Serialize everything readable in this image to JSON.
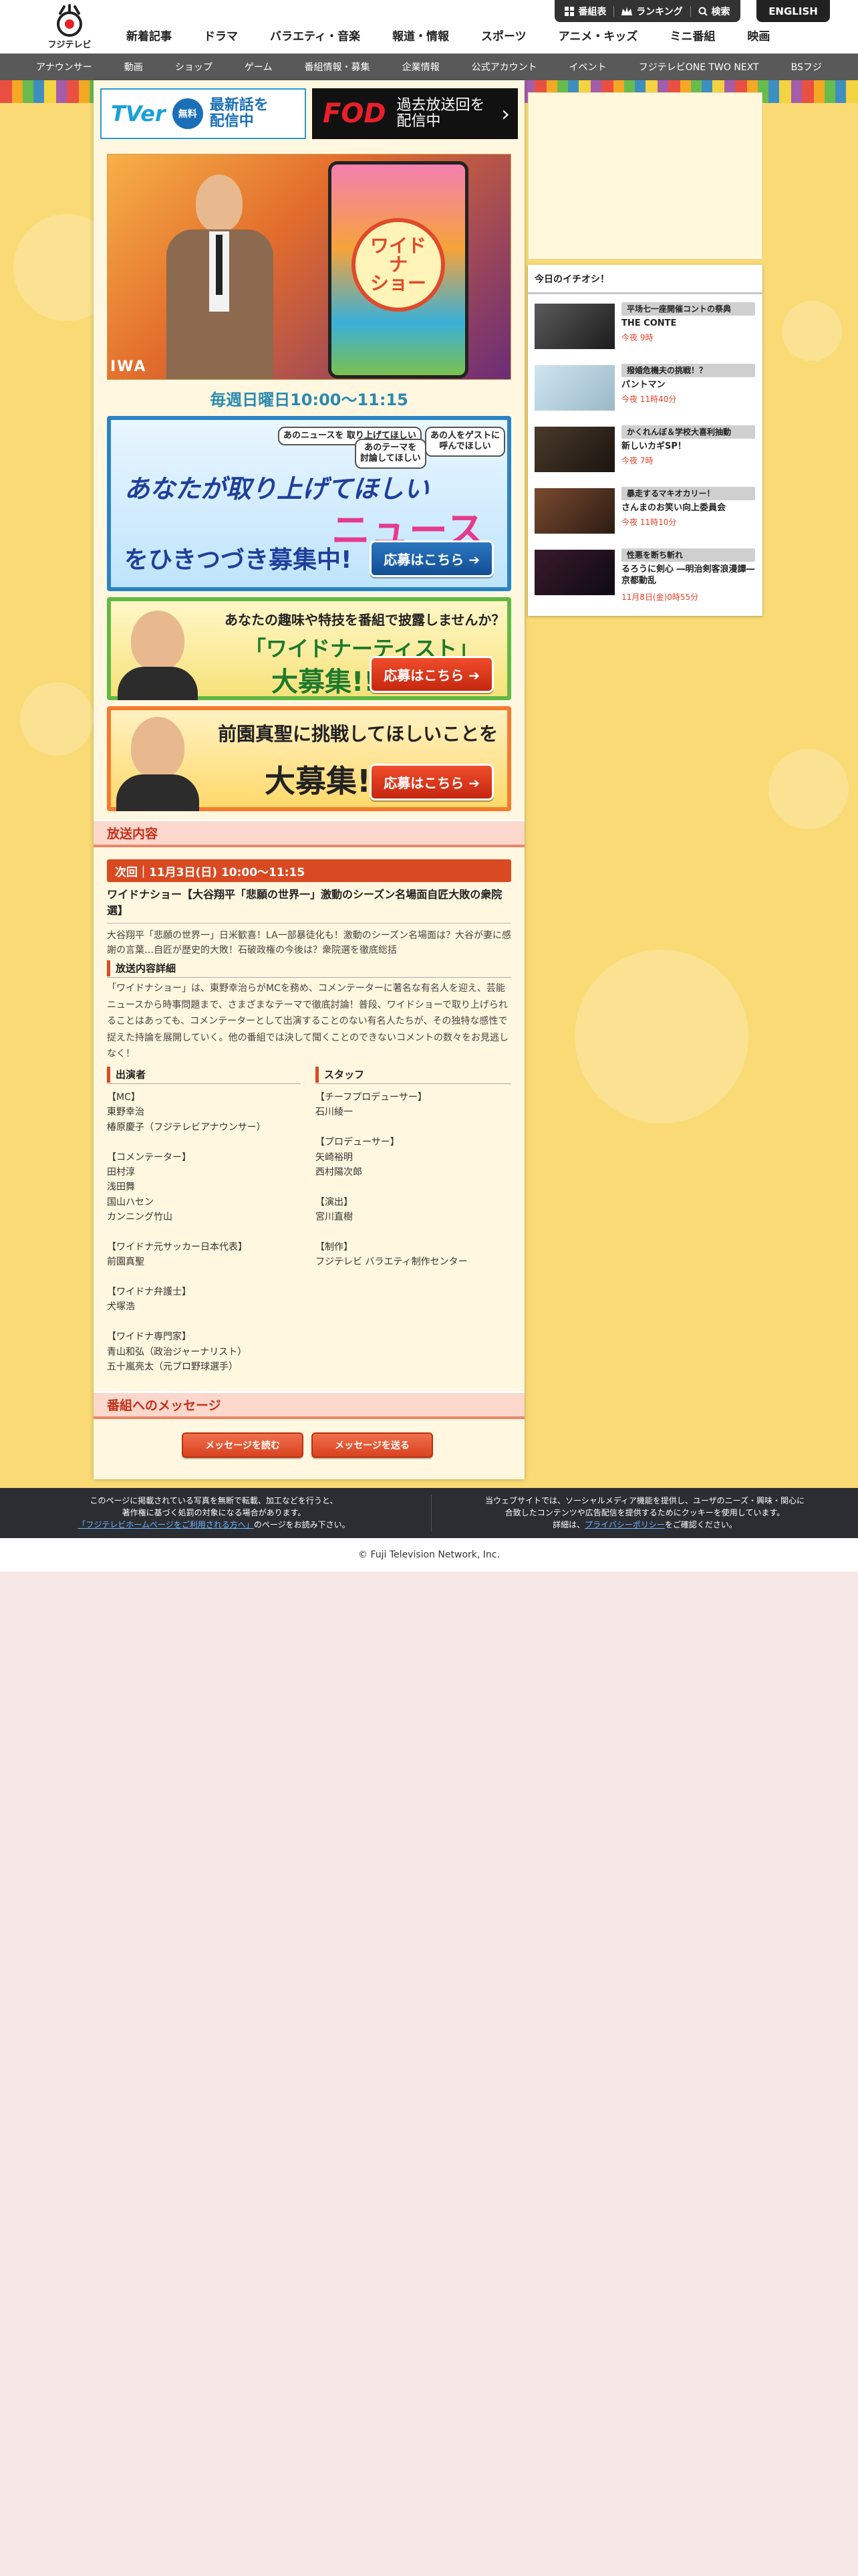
{
  "header": {
    "logo_text": "フジテレビ",
    "nav": [
      "新着記事",
      "ドラマ",
      "バラエティ・音楽",
      "報道・情報",
      "スポーツ",
      "アニメ・キッズ",
      "ミニ番組",
      "映画"
    ],
    "util": {
      "schedule": "番組表",
      "ranking": "ランキング",
      "search": "検索"
    },
    "english": "ENGLISH"
  },
  "subnav": [
    "アナウンサー",
    "動画",
    "ショップ",
    "ゲーム",
    "番組情報・募集",
    "企業情報",
    "公式アカウント",
    "イベント",
    "フジテレビONE TWO NEXT",
    "BSフジ"
  ],
  "banners": {
    "tver_logo": "TVer",
    "tver_free": "無料",
    "tver_msg": "最新話を\n配信中",
    "fod_logo": "FOD",
    "fod_msg": "過去放送回を\n配信中"
  },
  "hero": {
    "tag": "IWA",
    "phone_logo": "ワイド\nナ\nショー"
  },
  "airtime": "毎週日曜日10:00〜11:15",
  "promo1": {
    "bubble1": "あのニュースを\n取り上げてほしい",
    "bubble2": "あのテーマを\n討論してほしい",
    "bubble3": "あの人をゲストに\n呼んでほしい",
    "line1": "あなたが取り上げてほしい",
    "headline": "ニュース",
    "line2": "をひきつづき募集中!",
    "button": "応募はこちら ➔"
  },
  "promo2": {
    "question": "あなたの趣味や特技を番組で披露しませんか？",
    "line1": "「ワイドナーティスト」",
    "line2": "大募集!!",
    "button": "応募はこちら ➔"
  },
  "promo3": {
    "line1": "前園真聖に挑戦してほしいことを",
    "line2": "大募集!!",
    "button": "応募はこちら ➔"
  },
  "broadcast": {
    "heading": "放送内容",
    "next": "次回｜11月3日(日) 10:00〜11:15",
    "title": "ワイドナショー【大谷翔平「悲願の世界一」激動のシーズン名場面自匠大敗の衆院選】",
    "desc": "大谷翔平「悲願の世界一」日米歓喜！LA一部暴徒化も！激動のシーズン名場面は？大谷が妻に感謝の言葉…自匠が歴史的大敗！石破政権の今後は？衆院選を徹底総括",
    "detail_head": "放送内容詳細",
    "detail": "「ワイドナショー」は、東野幸治らがMCを務め、コメンテーターに著名な有名人を迎え、芸能ニュースから時事問題まで、さまざまなテーマで徹底討論！普段、ワイドショーで取り上げられることはあっても、コメンテーターとして出演することのない有名人たちが、その独特な感性で捉えた持論を展開していく。他の番組では決して聞くことのできないコメントの数々をお見逃しなく！",
    "cast_head": "出演者",
    "cast": "【MC】\n東野幸治\n椿原慶子（フジテレビアナウンサー）\n\n【コメンテーター】\n田村淳\n浅田舞\n国山ハセン\nカンニング竹山\n\n【ワイドナ元サッカー日本代表】\n前園真聖\n\n【ワイドナ弁護士】\n犬塚浩\n\n【ワイドナ専門家】\n青山和弘（政治ジャーナリスト）\n五十嵐亮太（元プロ野球選手）",
    "staff_head": "スタッフ",
    "staff": "【チーフプロデューサー】\n石川綾一\n\n【プロデューサー】\n矢崎裕明\n西村陽次郎\n\n【演出】\n宮川直樹\n\n【制作】\nフジテレビ バラエティ制作センター"
  },
  "message": {
    "heading": "番組へのメッセージ",
    "read": "メッセージを読む",
    "send": "メッセージを送る"
  },
  "sidebar": {
    "heading": "今日のイチオシ！",
    "picks": [
      {
        "cat": "平场七一座開催コントの祭典",
        "title": "THE CONTE",
        "time": "今夜 9時"
      },
      {
        "cat": "撥婚危機夫の挑戦！？",
        "title": "パントマン",
        "time": "今夜 11時40分"
      },
      {
        "cat": "かくれんぼ＆学校大喜利抽動",
        "title": "新しいカギSP！",
        "time": "今夜 7時"
      },
      {
        "cat": "暴走するマキオカリー！",
        "title": "さんまのお笑い向上委員会",
        "time": "今夜 11時10分"
      },
      {
        "cat": "性悪を断ち斬れ",
        "title": "るろうに剣心 ―明治剣客浪漫譚― 京都動乱",
        "time": "11月8日(金)0時55分"
      }
    ]
  },
  "footer": {
    "left1": "このページに掲載されている写真を無断で転載、加工などを行うと、",
    "left2": "著作権に基づく処罰の対象になる場合があります。",
    "left_link": "「フジテレビホームページをご利用される方へ」",
    "left3": "のページをお読み下さい。",
    "right1": "当ウェブサイトでは、ソーシャルメディア機能を提供し、ユーザのニーズ・興味・関心に",
    "right2": "合致したコンテンツや広告配信を提供するためにクッキーを使用しています。",
    "right3a": "詳細は、",
    "right_link": "プライバシーポリシー",
    "right3b": "をご確認ください。",
    "copyright": "© Fuji Television Network, Inc."
  },
  "colors": {
    "accent": "#d94a22",
    "airtime": "#2b8ab0",
    "background": "#f9da74"
  }
}
